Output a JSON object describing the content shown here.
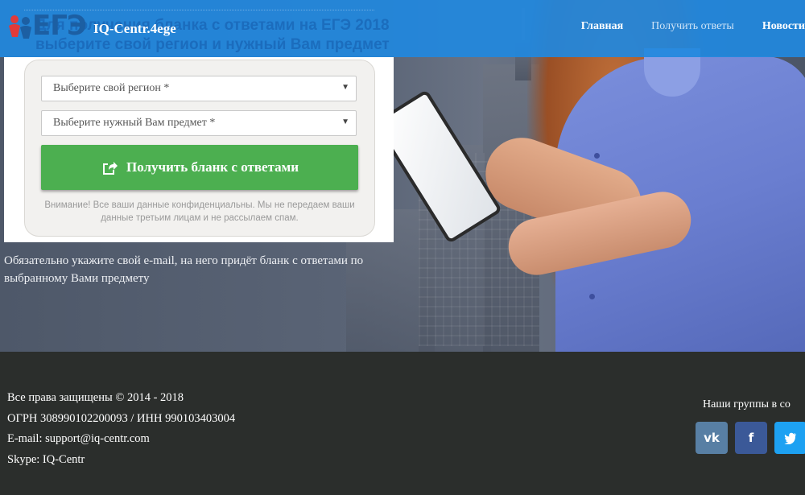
{
  "header": {
    "logo_text": "ЕГЭ",
    "brand_name": "IQ-Centr.4ege",
    "ghost_line1": "Для получения бланка с ответами на ЕГЭ 2018",
    "ghost_line2": "выберите свой регион и нужный Вам предмет",
    "nav": [
      {
        "label": "Главная"
      },
      {
        "label": "Получить ответы"
      },
      {
        "label": "Новости"
      }
    ]
  },
  "form": {
    "region_select": {
      "value": "Выберите свой регион *"
    },
    "subject_select": {
      "value": "Выберите нужный Вам предмет *"
    },
    "submit_label": "Получить бланк с ответами",
    "notice": "Внимание! Все ваши данные конфиденциальны. Мы не передаем ваши данные третьим лицам и не рассылаем спам."
  },
  "hint": "Обязательно укажите свой e-mail, на него придёт бланк с ответами по выбранному Вами предмету",
  "footer": {
    "rights": "Все права защищены  © 2014 - 2018",
    "ogrn": "ОГРН 308990102200093 / ИНН 990103403004",
    "email": "E-mail: support@iq-centr.com",
    "skype": "Skype: IQ-Centr",
    "groups_title": "Наши группы в со",
    "social": [
      {
        "label": "vk",
        "icon": "vk-icon"
      },
      {
        "label": "f",
        "icon": "facebook-icon"
      },
      {
        "label": "t",
        "icon": "twitter-icon"
      }
    ]
  },
  "colors": {
    "nav_bg": "#2188de",
    "cta": "#4caf50",
    "footer_bg": "#2b2e2c"
  }
}
